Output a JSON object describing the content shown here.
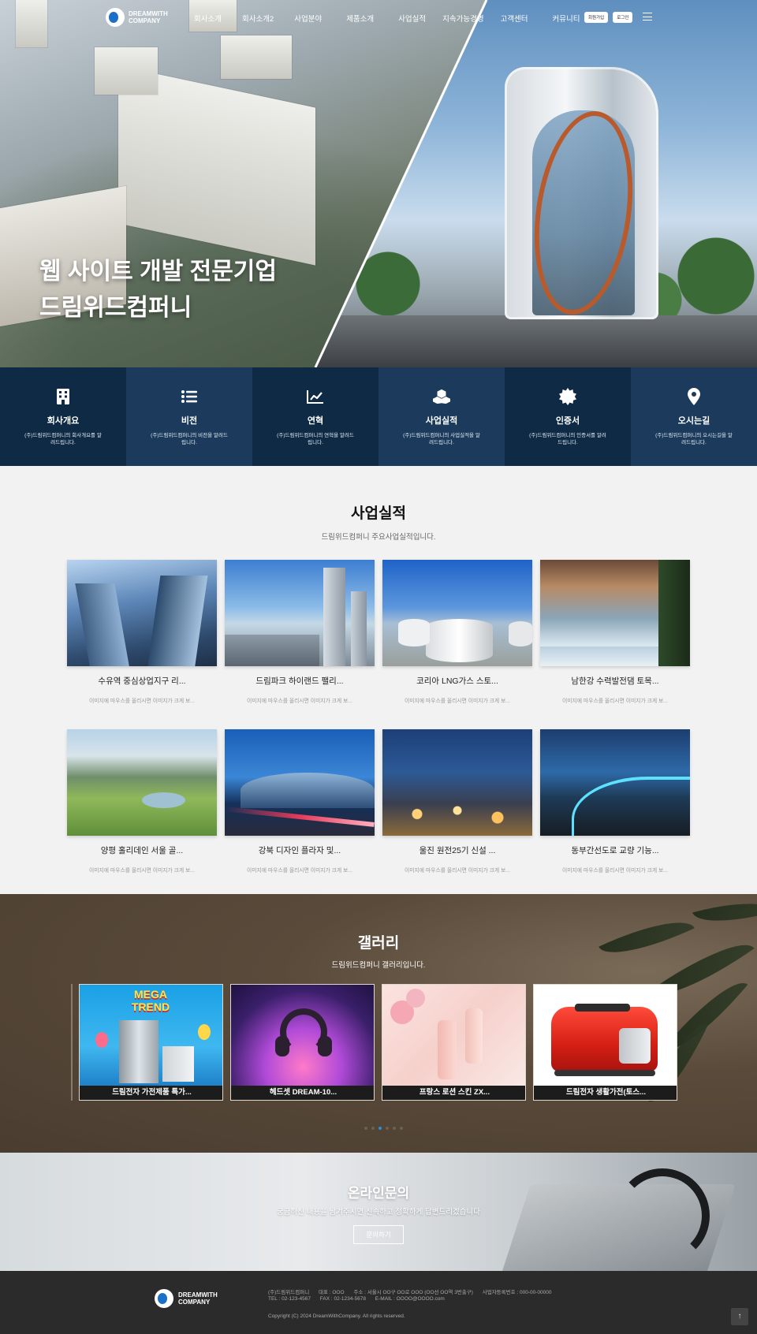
{
  "nav": {
    "logo_text": "DREAMWITH COMPANY",
    "menu": [
      "회사소개",
      "회사소개2",
      "사업분야",
      "제품소개",
      "사업실적",
      "지속가능경영",
      "고객센터",
      "커뮤니티"
    ],
    "signup_label": "회원가입",
    "login_label": "로그인"
  },
  "hero": {
    "line1": "웹 사이트 개발 전문기업",
    "line2": "드림위드컴퍼니"
  },
  "features": [
    {
      "icon": "building-icon",
      "title": "회사개요",
      "desc": "(주)드림위드컴퍼니의 회사개요를 알려드립니다."
    },
    {
      "icon": "list-icon",
      "title": "비전",
      "desc": "(주)드림위드컴퍼니의 비전을 알려드립니다."
    },
    {
      "icon": "chart-line-icon",
      "title": "연혁",
      "desc": "(주)드림위드컴퍼니의 연혁을 알려드립니다."
    },
    {
      "icon": "cubes-icon",
      "title": "사업실적",
      "desc": "(주)드림위드컴퍼니의 사업실적을 알려드립니다."
    },
    {
      "icon": "certificate-icon",
      "title": "인증서",
      "desc": "(주)드림위드컴퍼니의 인증서를 알려드립니다."
    },
    {
      "icon": "map-pin-icon",
      "title": "오시는길",
      "desc": "(주)드림위드컴퍼니의 오시는길을 알려드립니다."
    }
  ],
  "projects": {
    "title": "사업실적",
    "subtitle": "드림위드컴퍼니 주요사업실적입니다.",
    "items": [
      {
        "title": "수유역 중심상업지구 리...",
        "desc": "이미지에 마우스를 올리시면 이미지가 크게 보..."
      },
      {
        "title": "드림파크 하이랜드 팰리...",
        "desc": "이미지에 마우스를 올리시면 이미지가 크게 보..."
      },
      {
        "title": "코리아 LNG가스 스토...",
        "desc": "이미지에 마우스를 올리시면 이미지가 크게 보..."
      },
      {
        "title": "남한강 수력발전댐 토목...",
        "desc": "이미지에 마우스를 올리시면 이미지가 크게 보..."
      },
      {
        "title": "양평 홀리데인 서울 골...",
        "desc": "이미지에 마우스를 올리시면 이미지가 크게 보..."
      },
      {
        "title": "강북 디자인 플라자 및...",
        "desc": "이미지에 마우스를 올리시면 이미지가 크게 보..."
      },
      {
        "title": "울진 원전25기 신설 ...",
        "desc": "이미지에 마우스를 올리시면 이미지가 크게 보..."
      },
      {
        "title": "동부간선도로 교량 기능...",
        "desc": "이미지에 마우스를 올리시면 이미지가 크게 보..."
      }
    ]
  },
  "gallery": {
    "title": "갤러리",
    "subtitle": "드림위드컴퍼니 갤러리입니다.",
    "items": [
      {
        "title": "드림전자 가전제품 특가...",
        "badge": "MEGA TREND"
      },
      {
        "title": "헤드셋 DREAM-10..."
      },
      {
        "title": "프랑스 로션 스킨 ZX..."
      },
      {
        "title": "드림전자 생활가전(토스..."
      }
    ],
    "active_dot": 3,
    "dot_count": 6
  },
  "inquiry": {
    "title": "온라인문의",
    "subtitle": "궁금하신 내용을 남겨주시면 신속하고 정확하게 답변드리겠습니다",
    "button_label": "문의하기"
  },
  "footer": {
    "logo_text": "DREAMWITH COMPANY",
    "company": "(주)드림위드컴퍼니",
    "ceo": "대표 : OOO",
    "address": "주소 : 서울시 OO구 OO로 OOO (OO선 OO역 3번출구)",
    "bizno": "사업자등록번호 : 000-00-00000",
    "tel": "TEL : 02-123-4567",
    "fax": "FAX : 02-1234-5678",
    "email": "E-MAIL : OOOO@OOOO.com",
    "copyright": "Copyright (C) 2024 DreamWithCompany. All rights reserved."
  },
  "colors": {
    "feature_dark": "#0f2a45",
    "feature_light": "#1b3a5c",
    "accent": "#2c8fd8",
    "footer_bg": "#2b2b2b"
  }
}
